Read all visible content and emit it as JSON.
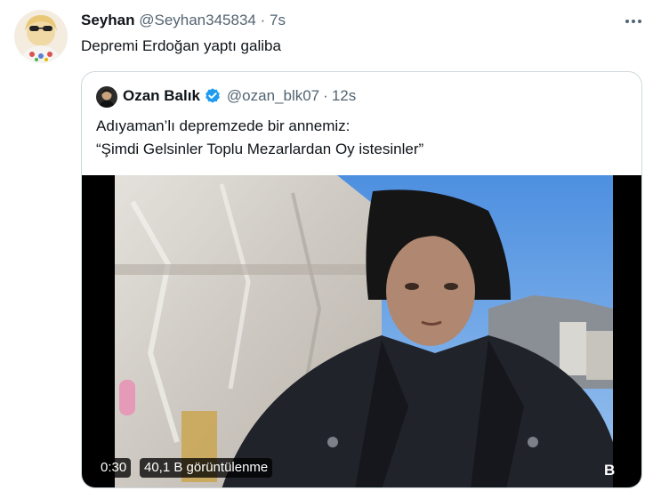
{
  "tweet": {
    "author_name": "Seyhan",
    "author_handle": "@Seyhan345834",
    "separator": "·",
    "timestamp": "7s",
    "text": "Depremi Erdoğan yaptı galiba"
  },
  "quoted_tweet": {
    "author_name": "Ozan Balık",
    "author_handle": "@ozan_blk07",
    "separator": "·",
    "timestamp": "12s",
    "verified": true,
    "text_line1": "Adıyaman’lı depremzede bir annemiz:",
    "text_line2": "“Şimdi Gelsinler Toplu Mezarlardan Oy istesinler”"
  },
  "video": {
    "duration": "0:30",
    "view_count": "40,1 B görüntülenme",
    "corner_text": "B"
  },
  "colors": {
    "text_primary": "#0f1419",
    "text_secondary": "#536471",
    "border": "#cfd9de",
    "verified_blue": "#1d9bf0"
  },
  "icons": {
    "more": "more-options-icon",
    "verified": "verified-badge-icon"
  }
}
